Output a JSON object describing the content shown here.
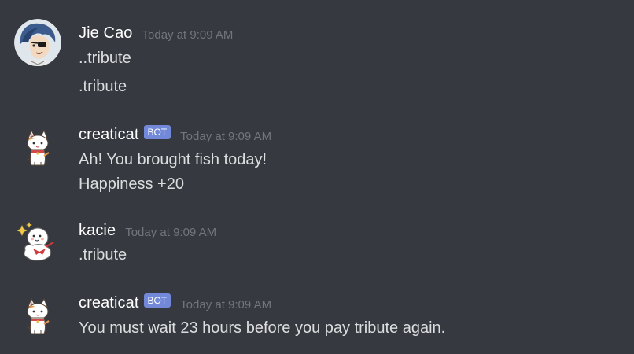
{
  "messages": [
    {
      "author": "Jie Cao",
      "is_bot": false,
      "timestamp": "Today at 9:09 AM",
      "avatar_icon": "jie-cao-avatar",
      "lines": [
        "..tribute",
        ".tribute"
      ]
    },
    {
      "author": "creaticat",
      "is_bot": true,
      "bot_label": "BOT",
      "timestamp": "Today at 9:09 AM",
      "avatar_icon": "cat-avatar",
      "lines": [
        "Ah! You brought fish today!",
        "Happiness +20"
      ]
    },
    {
      "author": "kacie",
      "is_bot": false,
      "timestamp": "Today at 9:09 AM",
      "avatar_icon": "kacie-avatar",
      "lines": [
        ".tribute"
      ]
    },
    {
      "author": "creaticat",
      "is_bot": true,
      "bot_label": "BOT",
      "timestamp": "Today at 9:09 AM",
      "avatar_icon": "cat-avatar",
      "lines": [
        "You must wait 23 hours before you pay tribute again."
      ]
    }
  ],
  "colors": {
    "background": "#36393f",
    "bot_tag": "#7289da",
    "timestamp": "#72767d",
    "message_text": "#dcddde"
  }
}
